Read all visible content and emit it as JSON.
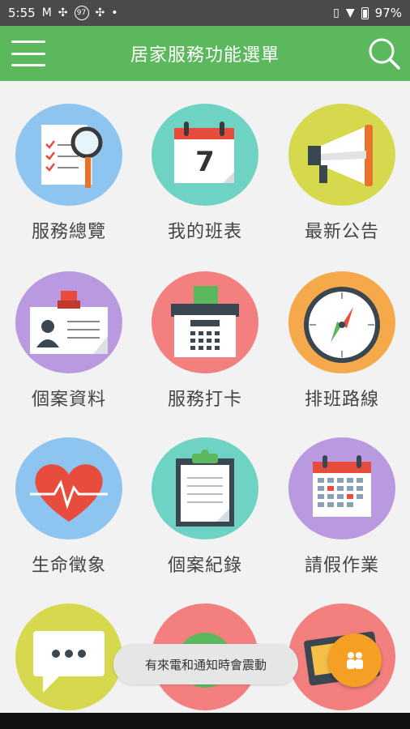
{
  "status_bar": {
    "time": "5:55",
    "badge": "97",
    "battery": "97%"
  },
  "app_bar": {
    "title": "居家服務功能選單"
  },
  "menu": {
    "items": [
      {
        "label": "服務總覽",
        "icon": "checklist-magnifier-icon",
        "color": "#8ec5f0"
      },
      {
        "label": "我的班表",
        "icon": "calendar-icon",
        "color": "#6fd3c3"
      },
      {
        "label": "最新公告",
        "icon": "megaphone-icon",
        "color": "#d6d94e"
      },
      {
        "label": "個案資料",
        "icon": "id-card-icon",
        "color": "#b99ae0"
      },
      {
        "label": "服務打卡",
        "icon": "punch-clock-icon",
        "color": "#f47f7f"
      },
      {
        "label": "排班路線",
        "icon": "compass-icon",
        "color": "#f5a94a"
      },
      {
        "label": "生命徵象",
        "icon": "heartbeat-icon",
        "color": "#8ec5f0"
      },
      {
        "label": "個案紀錄",
        "icon": "clipboard-icon",
        "color": "#6fd3c3"
      },
      {
        "label": "請假作業",
        "icon": "calendar-grid-icon",
        "color": "#b99ae0"
      },
      {
        "label": "",
        "icon": "chat-bubble-icon",
        "color": "#d6d94e"
      },
      {
        "label": "",
        "icon": "money-icon",
        "color": "#f47f7f"
      },
      {
        "label": "",
        "icon": "wallet-icon",
        "color": "#f47f7f"
      }
    ]
  },
  "calendar_day": "7",
  "toast": {
    "text": "有來電和通知時會震動"
  },
  "fab": {
    "icon": "people-icon",
    "color": "#f5a025"
  }
}
